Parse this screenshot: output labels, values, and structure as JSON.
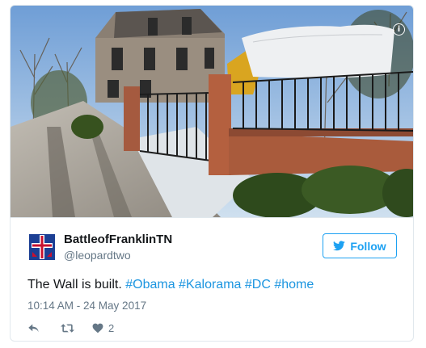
{
  "photo": {
    "alt_icon": "i"
  },
  "user": {
    "display_name": "BattleofFranklinTN",
    "handle": "@leopardtwo",
    "avatar_icon": "cross-flag-icon"
  },
  "follow_button": {
    "label": "Follow",
    "icon": "twitter-bird-icon"
  },
  "tweet": {
    "text_plain": "The Wall is built. ",
    "hashtags": [
      "#Obama",
      "#Kalorama",
      "#DC",
      "#home"
    ],
    "timestamp": "10:14 AM - 24 May 2017"
  },
  "actions": {
    "reply_icon": "reply-icon",
    "retweet_icon": "retweet-icon",
    "like_icon": "heart-icon",
    "like_count": "2"
  },
  "colors": {
    "accent": "#1da1f2",
    "hashtag": "#1b95e0",
    "secondary_text": "#657786",
    "border": "#e1e8ed"
  }
}
